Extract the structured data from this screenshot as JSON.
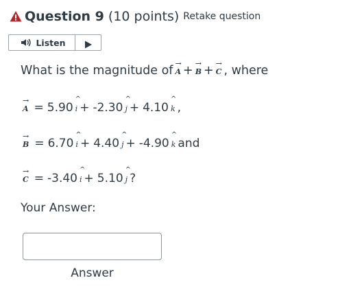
{
  "header": {
    "title": "Question 9",
    "points": "(10 points)",
    "retake": "Retake question",
    "warning_color": "#b5262a"
  },
  "listen": {
    "label": "Listen",
    "icons": [
      "speaker-icon",
      "play-icon"
    ]
  },
  "question": {
    "prompt_prefix": "What is the magnitude of",
    "vectors": [
      "A",
      "B",
      "C"
    ],
    "plus": "+",
    "where": ", where",
    "eq1": {
      "vector": "A",
      "eq": "=",
      "i_coef": "5.90",
      "j_coef": "-2.30",
      "k_coef": "4.10",
      "tail": ","
    },
    "eq2": {
      "vector": "B",
      "eq": "=",
      "i_coef": "6.70",
      "j_coef": "4.40",
      "k_coef": "-4.90",
      "tail": "and"
    },
    "eq3": {
      "vector": "C",
      "eq": "=",
      "i_coef": "-3.40",
      "j_coef": "5.10",
      "tail": "?"
    },
    "units": {
      "i": "i",
      "j": "j",
      "k": "k"
    },
    "arrow": "→",
    "hat": "^"
  },
  "answer": {
    "heading": "Your Answer:",
    "value": "",
    "placeholder": "",
    "label": "Answer"
  }
}
